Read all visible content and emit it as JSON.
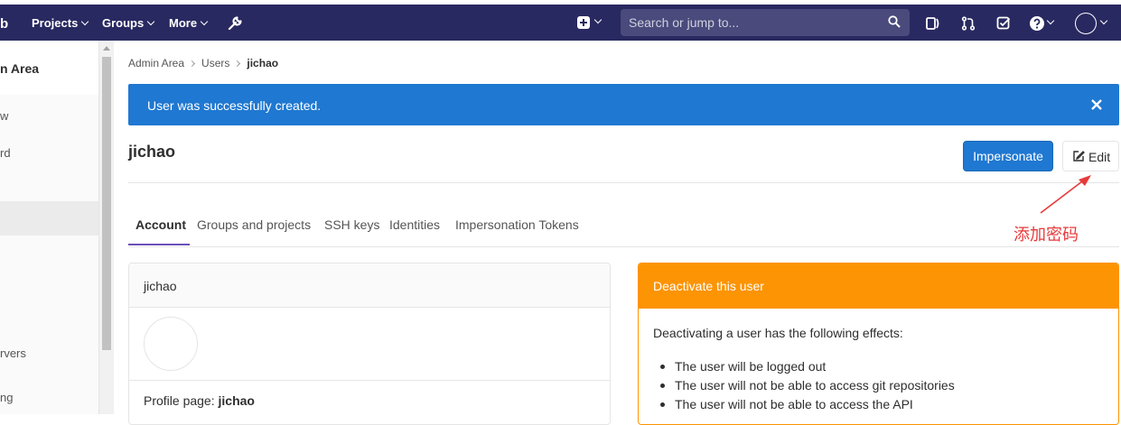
{
  "navbar": {
    "logo": "b",
    "projects": "Projects",
    "groups": "Groups",
    "more": "More",
    "search_placeholder": "Search or jump to..."
  },
  "sidebar": {
    "header": "n Area",
    "items": [
      "w",
      "rd",
      "rvers",
      "ng"
    ]
  },
  "breadcrumb": [
    "Admin Area",
    "Users",
    "jichao"
  ],
  "alert": {
    "message": "User was successfully created."
  },
  "page": {
    "title": "jichao",
    "impersonate_label": "Impersonate",
    "edit_label": "Edit"
  },
  "annotation": {
    "text": "添加密码",
    "color": "#e8393a"
  },
  "tabs": [
    "Account",
    "Groups and projects",
    "SSH keys",
    "Identities",
    "Impersonation Tokens"
  ],
  "profile_card": {
    "header": "jichao",
    "profile_label": "Profile page:",
    "profile_value": "jichao"
  },
  "deactivate_card": {
    "header": "Deactivate this user",
    "intro": "Deactivating a user has the following effects:",
    "effects": [
      "The user will be logged out",
      "The user will not be able to access git repositories",
      "The user will not be able to access the API"
    ],
    "color": "#fc9403"
  },
  "colors": {
    "navbar": "#292961",
    "primary": "#1f78d1",
    "tab_active": "#6b4fbb"
  }
}
